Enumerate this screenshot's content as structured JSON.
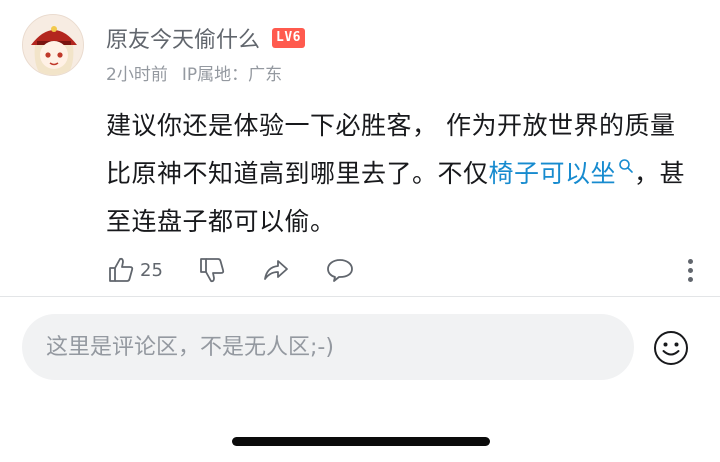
{
  "comment": {
    "username": "原友今天偷什么",
    "level_badge": "LV6",
    "time": "2小时前",
    "ip_location": "IP属地：广东",
    "content_part1": "建议你还是体验一下必胜客， 作为开放世界的质量比原神不知道高到哪里去了。不仅",
    "content_link": "椅子可以坐",
    "content_part2": "，甚至连盘子都可以偷。",
    "like_count": "25"
  },
  "input": {
    "placeholder": "这里是评论区，不是无人区;-)"
  },
  "colors": {
    "link": "#178bcf",
    "badge": "#ff5a4e",
    "text_secondary": "#9499a0"
  },
  "icons": [
    "avatar-image",
    "like-icon",
    "dislike-icon",
    "share-icon",
    "reply-icon",
    "more-icon",
    "search-icon",
    "emoji-icon"
  ]
}
